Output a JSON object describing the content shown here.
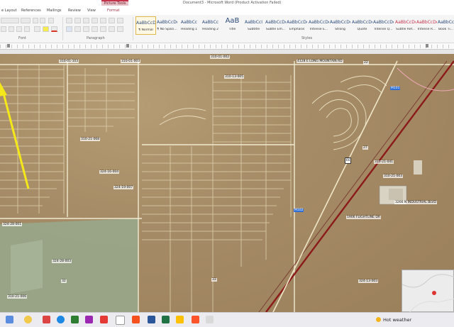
{
  "window": {
    "document_title": "Document3 - Microsoft Word (Product Activation Failed)",
    "context_tab_header": "Picture Tools"
  },
  "ribbon_tabs": [
    "e Layout",
    "References",
    "Mailings",
    "Review",
    "View",
    "Format"
  ],
  "ribbon_groups": {
    "font": "Font",
    "paragraph": "Paragraph",
    "styles": "Styles"
  },
  "styles": [
    {
      "preview": "AaBbCcDc",
      "name": "¶ Normal",
      "selected": true
    },
    {
      "preview": "AaBbCcDc",
      "name": "¶ No Spaci..."
    },
    {
      "preview": "AaBbCc",
      "name": "Heading 1"
    },
    {
      "preview": "AaBbCc",
      "name": "Heading 2"
    },
    {
      "preview": "AaB",
      "name": "Title",
      "big": true
    },
    {
      "preview": "AaBbCcI",
      "name": "Subtitle"
    },
    {
      "preview": "AaBbCcDc",
      "name": "Subtle Em..."
    },
    {
      "preview": "AaBbCcDc",
      "name": "Emphasis"
    },
    {
      "preview": "AaBbCcDc",
      "name": "Intense E..."
    },
    {
      "preview": "AaBbCcDc",
      "name": "Strong"
    },
    {
      "preview": "AaBbCcDc",
      "name": "Quote"
    },
    {
      "preview": "AaBbCcDc",
      "name": "Intense Q..."
    },
    {
      "preview": "AaBbCcDc",
      "name": "Subtle Ref..."
    },
    {
      "preview": "AaBbCcDc",
      "name": "Intense R..."
    },
    {
      "preview": "AaBbCcDc",
      "name": "Book Ti..."
    }
  ],
  "map_labels": {
    "parcel_a": "310-01-003",
    "parcel_b": "310-01-002",
    "parcel_c": "310-01-103",
    "parcel_d": "310-21-003",
    "parcel_e": "310-21-068",
    "parcel_f": "310-13-005",
    "parcel_g": "324-28-001",
    "parcel_h": "324-28-003",
    "parcel_i": "324-19-007",
    "parcel_j": "324-16-004",
    "parcel_k": "324-13-003",
    "parcel_l": "310-21-041",
    "parcel_m": "310-21-006",
    "street_long_mountain": "4128 E LONG MOUNTAIN RD",
    "street_flightline": "1906 FLIGHTLINE DR",
    "street_ne": "3266 N INDUSTRIAL BLVD",
    "section_22": "22",
    "section_27": "27",
    "section_32": "32",
    "section_33": "33",
    "highway": "66",
    "marker_1": "M101",
    "marker_2": "M102"
  },
  "taskbar": {
    "weather": "Hot weather"
  },
  "colors": {
    "accent": "#c4314b",
    "highlight_arrow": "#f5e81a",
    "railway": "#8b1a1a"
  }
}
